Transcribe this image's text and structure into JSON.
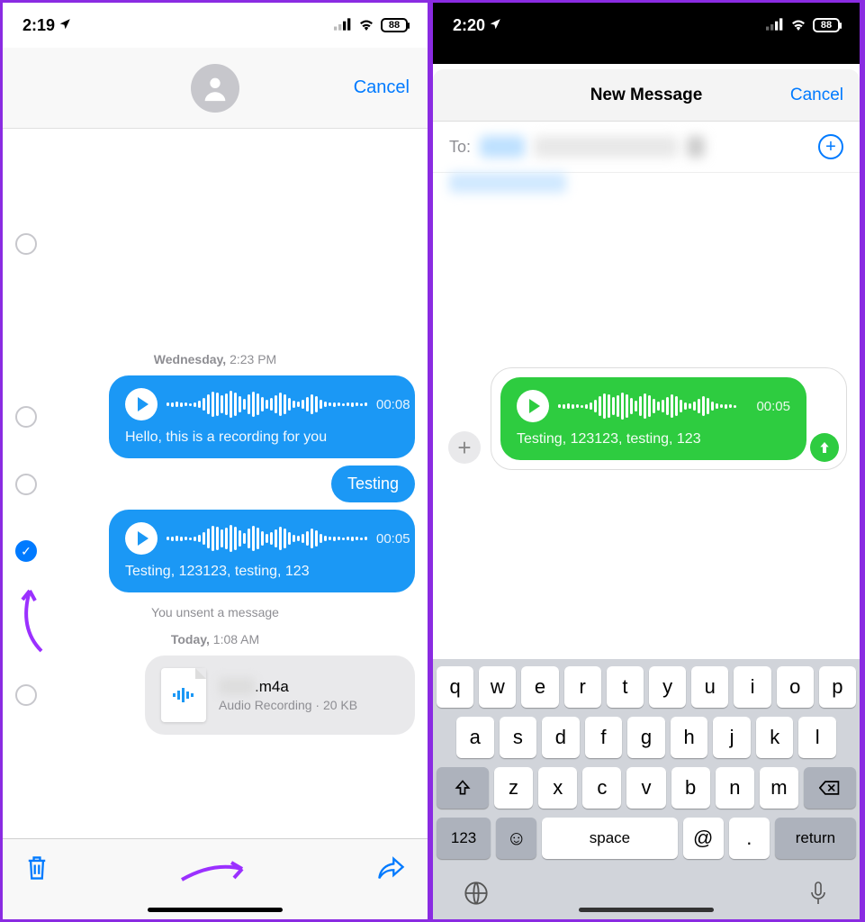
{
  "left": {
    "status": {
      "time": "2:19",
      "battery": "88"
    },
    "cancel": "Cancel",
    "timestamp1_day": "Wednesday,",
    "timestamp1_time": "2:23 PM",
    "audio1": {
      "duration": "00:08",
      "caption": "Hello, this is a recording for you"
    },
    "msg_testing": "Testing",
    "audio2": {
      "duration": "00:05",
      "caption": "Testing, 123123, testing, 123"
    },
    "unsent": "You unsent a message",
    "timestamp2_day": "Today,",
    "timestamp2_time": "1:08 AM",
    "file": {
      "name": ".m4a",
      "meta": "Audio Recording · 20 KB"
    }
  },
  "right": {
    "status": {
      "time": "2:20",
      "battery": "88"
    },
    "title": "New Message",
    "cancel": "Cancel",
    "to_label": "To:",
    "audio": {
      "duration": "00:05",
      "caption": "Testing, 123123, testing, 123"
    },
    "keys": {
      "row1": [
        "q",
        "w",
        "e",
        "r",
        "t",
        "y",
        "u",
        "i",
        "o",
        "p"
      ],
      "row2": [
        "a",
        "s",
        "d",
        "f",
        "g",
        "h",
        "j",
        "k",
        "l"
      ],
      "row3": [
        "z",
        "x",
        "c",
        "v",
        "b",
        "n",
        "m"
      ],
      "num": "123",
      "space": "space",
      "at": "@",
      "dot": ".",
      "ret": "return"
    }
  }
}
